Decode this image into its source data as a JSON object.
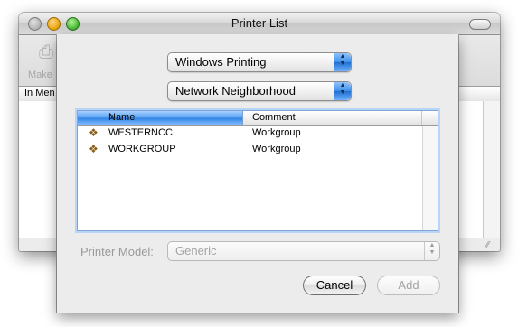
{
  "window": {
    "title": "Printer List",
    "toolbar": {
      "make_default_label": "Make"
    },
    "list_header": {
      "column_in_menu": "In Men"
    }
  },
  "sheet": {
    "connection_popup": {
      "selected": "Windows Printing"
    },
    "browse_popup": {
      "selected": "Network Neighborhood"
    },
    "table": {
      "columns": {
        "name": "Name",
        "comment": "Comment"
      },
      "sort_indicator": "▲",
      "rows": [
        {
          "icon": "workgroup-printer-icon",
          "name": "WESTERNCC",
          "comment": "Workgroup"
        },
        {
          "icon": "workgroup-printer-icon",
          "name": "WORKGROUP",
          "comment": "Workgroup"
        }
      ]
    },
    "printer_model": {
      "label": "Printer Model:",
      "selected": "Generic"
    },
    "buttons": {
      "cancel": "Cancel",
      "add": "Add"
    }
  },
  "colors": {
    "selection_blue": "#3b8de7",
    "focus_ring": "#b8d4f6"
  }
}
